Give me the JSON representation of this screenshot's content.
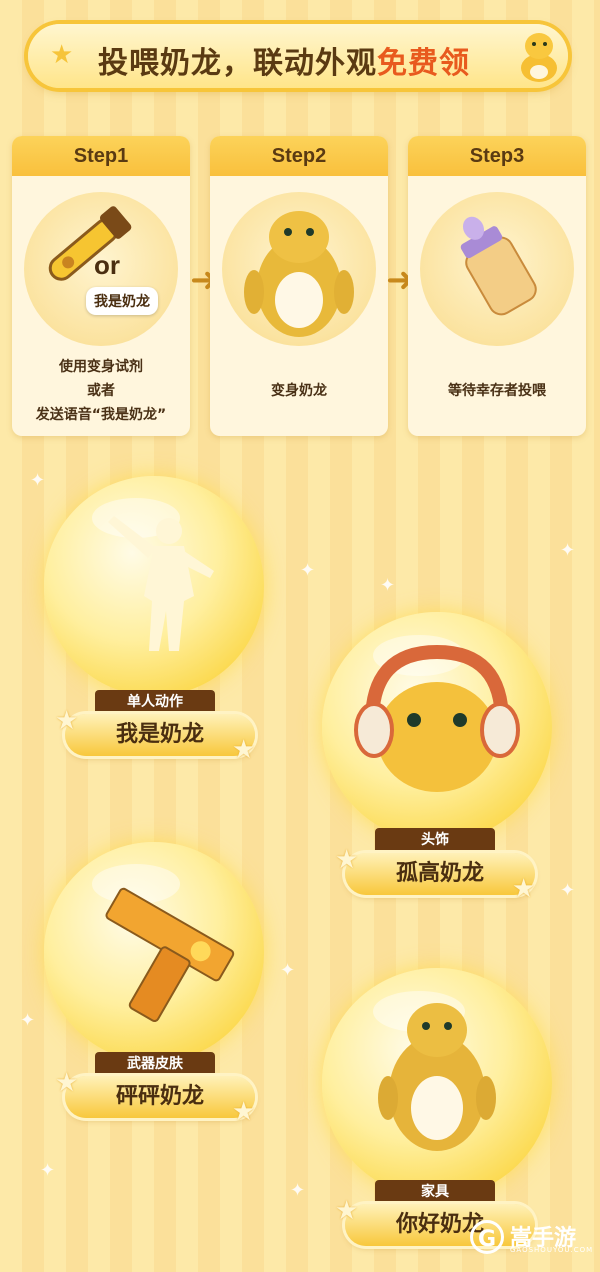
{
  "banner": {
    "title_main": "投喂奶龙，联动外观",
    "title_highlight": "免费领"
  },
  "steps": [
    {
      "label": "Step1",
      "or_text": "or",
      "speech": "我是奶龙",
      "desc_lines": [
        "使用变身试剂",
        "或者",
        "发送语音“我是奶龙”"
      ]
    },
    {
      "label": "Step2",
      "desc_lines": [
        "变身奶龙"
      ]
    },
    {
      "label": "Step3",
      "desc_lines": [
        "等待幸存者投喂"
      ]
    }
  ],
  "rewards": [
    {
      "category": "单人动作",
      "name": "我是奶龙"
    },
    {
      "category": "头饰",
      "name": "孤高奶龙"
    },
    {
      "category": "武器皮肤",
      "name": "砰砰奶龙"
    },
    {
      "category": "家具",
      "name": "你好奶龙"
    }
  ],
  "footer": {
    "brand": "嵩手游",
    "domain": "GAOSHOUYOU.COM",
    "logo_letter": "G"
  },
  "colors": {
    "accent": "#e85a1e",
    "dark_brown": "#5a3a12",
    "gold": "#f9c03c"
  }
}
